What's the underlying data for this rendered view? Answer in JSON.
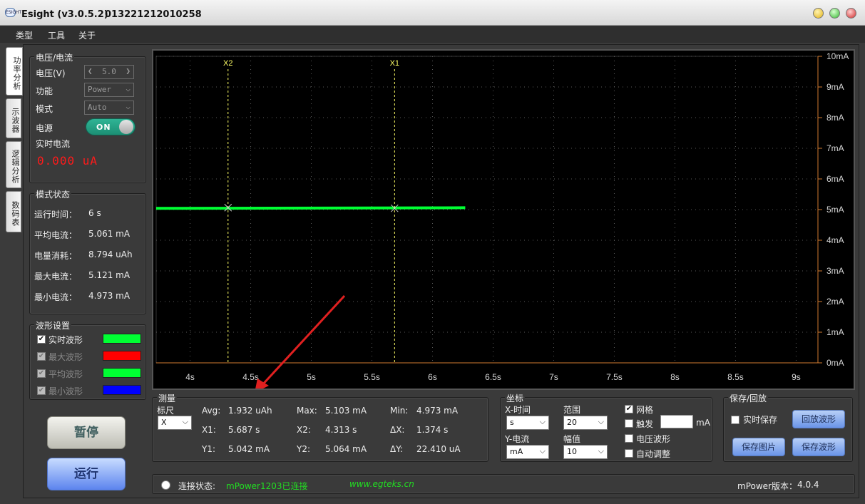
{
  "window": {
    "title": "Esight (v3.0.5.2)",
    "serial": "013221212010258",
    "logo_text": "ESIGHT"
  },
  "menu": [
    "类型",
    "工具",
    "关于"
  ],
  "side_tabs": [
    "功率分析",
    "示波器",
    "逻辑分析",
    "数码表"
  ],
  "voltage": {
    "title": "电压/电流",
    "voltage_label": "电压(V)",
    "voltage_value": "5.0",
    "function_label": "功能",
    "function_value": "Power",
    "mode_label": "模式",
    "mode_value": "Auto",
    "power_label": "电源",
    "power_value": "ON",
    "live_label": "实时电流",
    "live_value": "0.000 uA"
  },
  "mode_status": {
    "title": "模式状态",
    "rows": [
      {
        "label": "运行时间：",
        "value": "6 s"
      },
      {
        "label": "平均电流：",
        "value": "5.061 mA"
      },
      {
        "label": "电量消耗：",
        "value": "8.794 uAh"
      },
      {
        "label": "最大电流：",
        "value": "5.121 mA"
      },
      {
        "label": "最小电流：",
        "value": "4.973 mA"
      }
    ]
  },
  "wave_settings": {
    "title": "波形设置",
    "items": [
      {
        "label": "实时波形",
        "color": "#00ff33",
        "checked": true,
        "enabled": true
      },
      {
        "label": "最大波形",
        "color": "#ff0000",
        "checked": true,
        "enabled": false
      },
      {
        "label": "平均波形",
        "color": "#00ff33",
        "checked": true,
        "enabled": false
      },
      {
        "label": "最小波形",
        "color": "#0000ff",
        "checked": true,
        "enabled": false
      }
    ]
  },
  "buttons": {
    "pause": "暂停",
    "run": "运行"
  },
  "chart_data": {
    "type": "line",
    "x_ticks": [
      "4s",
      "4.5s",
      "5s",
      "5.5s",
      "6s",
      "6.5s",
      "7s",
      "7.5s",
      "8s",
      "8.5s",
      "9s"
    ],
    "y_ticks": [
      "10mA",
      "9mA",
      "8mA",
      "7mA",
      "6mA",
      "5mA",
      "4mA",
      "3mA",
      "2mA",
      "1mA",
      "0mA"
    ],
    "xlim": [
      3.72,
      9.18
    ],
    "ylim": [
      0,
      10
    ],
    "grid": true,
    "series": [
      {
        "color": "#00ff33",
        "x": [
          3.72,
          6.27
        ],
        "y": [
          5.04,
          5.06
        ]
      }
    ],
    "cursors": [
      {
        "label": "X2",
        "x": 4.313,
        "y": 5.064
      },
      {
        "label": "X1",
        "x": 5.687,
        "y": 5.042
      }
    ]
  },
  "measure": {
    "title": "测量",
    "ruler_label": "标尺",
    "ruler_value": "X",
    "avg_label": "Avg:",
    "avg_value": "1.932 uAh",
    "max_label": "Max:",
    "max_value": "5.103 mA",
    "min_label": "Min:",
    "min_value": "4.973 mA",
    "x1_label": "X1:",
    "x1_value": "5.687 s",
    "x2_label": "X2:",
    "x2_value": "4.313 s",
    "dx_label": "ΔX:",
    "dx_value": "1.374 s",
    "y1_label": "Y1:",
    "y1_value": "5.042 mA",
    "y2_label": "Y2:",
    "y2_value": "5.064 mA",
    "dy_label": "ΔY:",
    "dy_value": "22.410 uA"
  },
  "coords": {
    "title": "坐标",
    "x_label": "X-时间",
    "x_unit": "s",
    "range_label": "范围",
    "range_value": "20",
    "y_label": "Y-电流",
    "y_unit": "mA",
    "amp_label": "幅值",
    "amp_value": "10",
    "grid_label": "网格",
    "grid_checked": true,
    "trigger_label": "触发",
    "trigger_unit": "mA",
    "trigger_value": "",
    "voltage_wave_label": "电压波形",
    "auto_adjust_label": "自动调整"
  },
  "save": {
    "title": "保存/回放",
    "realtime_label": "实时保存",
    "replay": "回放波形",
    "save_image": "保存图片",
    "save_wave": "保存波形"
  },
  "status": {
    "label": "连接状态:",
    "value": "mPower1203已连接",
    "url": "www.egteks.cn",
    "version_label": "mPower版本：",
    "version_value": "4.0.4"
  },
  "colors": {
    "accent_green": "#00ff33",
    "live_red": "#ff1a1a",
    "cursor_yellow": "#ffff66"
  }
}
